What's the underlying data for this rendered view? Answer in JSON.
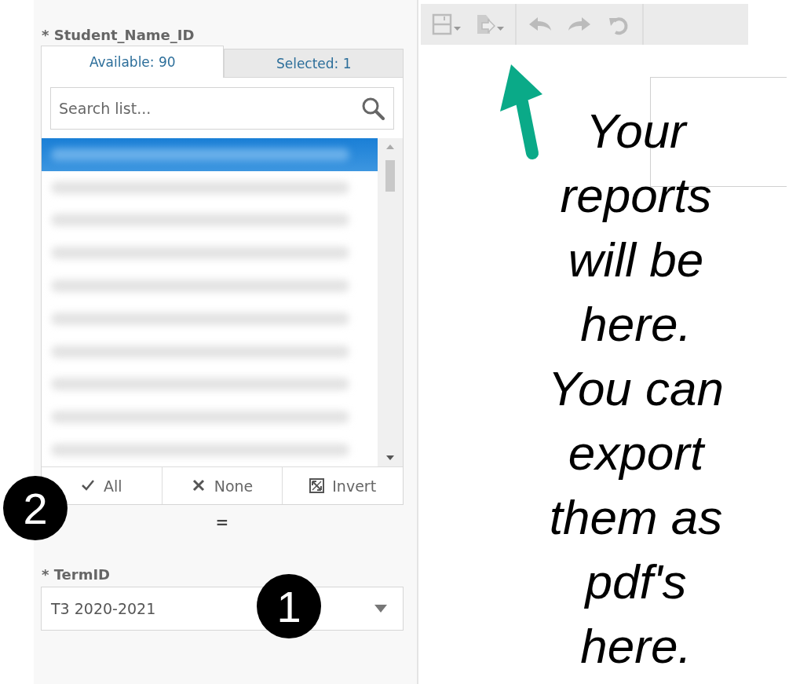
{
  "parameter_panel": {
    "student_field": {
      "label": "* Student_Name_ID",
      "tabs": [
        {
          "label": "Available: 90",
          "selected": true
        },
        {
          "label": "Selected: 1",
          "selected": false
        }
      ],
      "search": {
        "placeholder": "Search list..."
      },
      "rows": [
        {
          "selected": true
        },
        {
          "selected": false
        },
        {
          "selected": false
        },
        {
          "selected": false
        },
        {
          "selected": false
        },
        {
          "selected": false
        },
        {
          "selected": false
        },
        {
          "selected": false
        },
        {
          "selected": false
        },
        {
          "selected": false
        }
      ],
      "buttons": [
        {
          "kind": "check",
          "label": "All"
        },
        {
          "kind": "cross",
          "label": "None"
        },
        {
          "kind": "invert",
          "label": "Invert"
        }
      ]
    },
    "splitter": "=",
    "term_field": {
      "label": "* TermID",
      "value": "T3 2020-2021"
    }
  },
  "toolbar": {
    "groups": [
      [
        {
          "kind": "save"
        },
        {
          "kind": "export"
        }
      ],
      [
        {
          "kind": "undo"
        },
        {
          "kind": "redo"
        },
        {
          "kind": "reset"
        }
      ]
    ]
  },
  "annotation": {
    "lines": [
      "Your",
      "reports",
      "will be",
      "here.",
      "You can",
      "export",
      "them as",
      "pdf's",
      "here."
    ]
  },
  "badges": [
    {
      "number": "2",
      "kind": "buttons"
    },
    {
      "number": "1",
      "kind": "term"
    }
  ]
}
